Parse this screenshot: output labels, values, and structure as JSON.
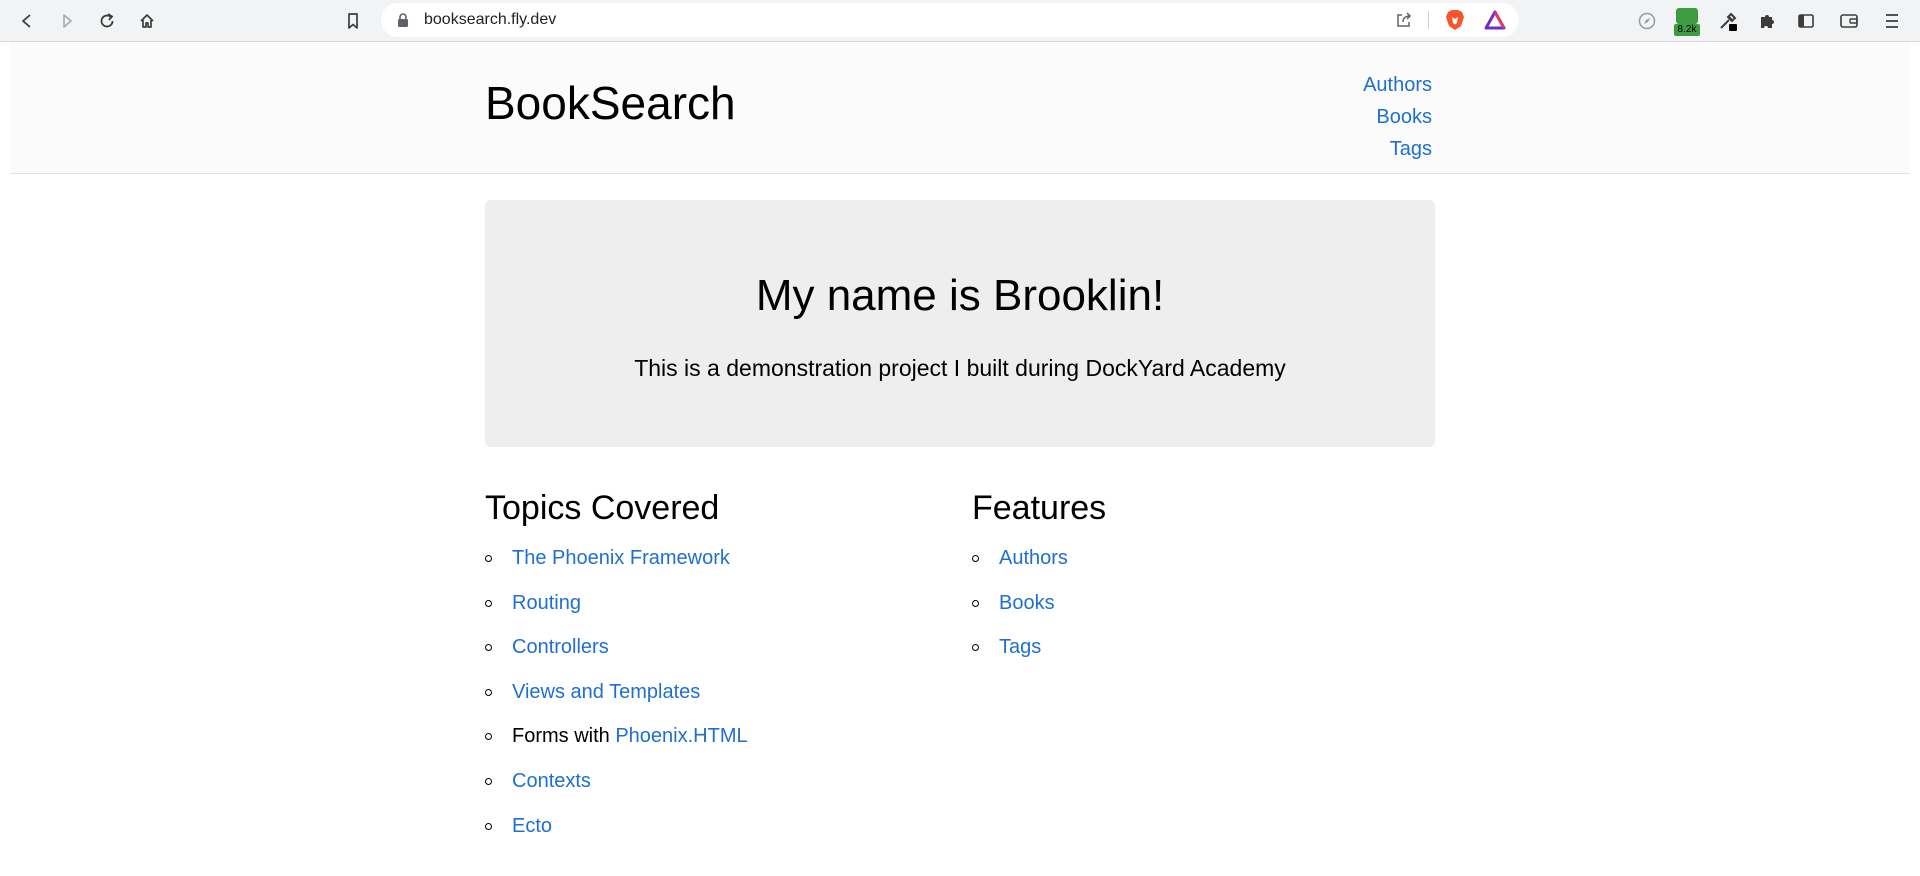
{
  "browser": {
    "url": "booksearch.fly.dev",
    "extension_badge_count": "8.2k"
  },
  "header": {
    "logo": "BookSearch",
    "nav": [
      "Authors",
      "Books",
      "Tags"
    ]
  },
  "hero": {
    "title": "My name is Brooklin!",
    "subtitle": "This is a demonstration project I built during DockYard Academy"
  },
  "topics": {
    "heading": "Topics Covered",
    "items": [
      {
        "prefix": "",
        "link": "The Phoenix Framework"
      },
      {
        "prefix": "",
        "link": "Routing"
      },
      {
        "prefix": "",
        "link": "Controllers"
      },
      {
        "prefix": "",
        "link": "Views and Templates"
      },
      {
        "prefix": "Forms with ",
        "link": "Phoenix.HTML"
      },
      {
        "prefix": "",
        "link": "Contexts"
      },
      {
        "prefix": "",
        "link": "Ecto"
      }
    ]
  },
  "features": {
    "heading": "Features",
    "items": [
      "Authors",
      "Books",
      "Tags"
    ]
  },
  "colors": {
    "link": "#1f6fd1",
    "hero_bg": "#eeeeee",
    "header_bg": "#fbfbfb",
    "chrome_bg": "#f1f3f4"
  }
}
